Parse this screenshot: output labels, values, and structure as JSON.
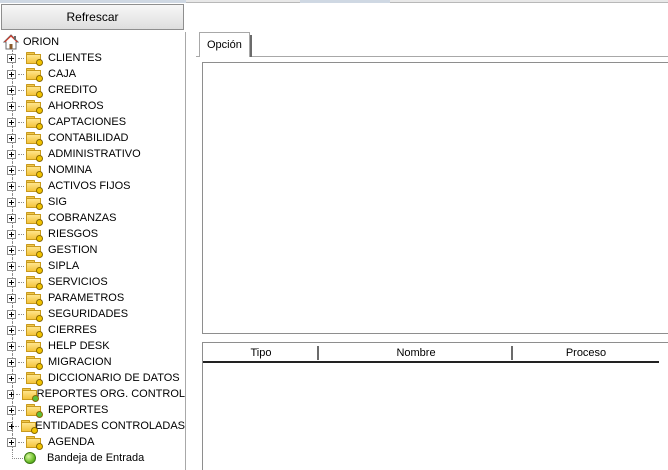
{
  "toolbar": {
    "refresh_label": "Refrescar"
  },
  "tree": {
    "root": "ORION",
    "modules": [
      {
        "label": "CLIENTES",
        "dot": "#f2c400"
      },
      {
        "label": "CAJA",
        "dot": "#f2c400"
      },
      {
        "label": "CREDITO",
        "dot": "#f2c400"
      },
      {
        "label": "AHORROS",
        "dot": "#f2c400"
      },
      {
        "label": "CAPTACIONES",
        "dot": "#f2c400"
      },
      {
        "label": "CONTABILIDAD",
        "dot": "#f2c400"
      },
      {
        "label": "ADMINISTRATIVO",
        "dot": "#f2c400"
      },
      {
        "label": "NOMINA",
        "dot": "#f2c400"
      },
      {
        "label": "ACTIVOS FIJOS",
        "dot": "#f2c400"
      },
      {
        "label": "SIG",
        "dot": "#f2c400"
      },
      {
        "label": "COBRANZAS",
        "dot": "#f2c400"
      },
      {
        "label": "RIESGOS",
        "dot": "#f2c400"
      },
      {
        "label": "GESTION",
        "dot": "#f2c400"
      },
      {
        "label": "SIPLA",
        "dot": "#f2c400"
      },
      {
        "label": "SERVICIOS",
        "dot": "#f2c400"
      },
      {
        "label": "PARAMETROS",
        "dot": "#f2c400"
      },
      {
        "label": "SEGURIDADES",
        "dot": "#f2c400"
      },
      {
        "label": "CIERRES",
        "dot": "#f2c400"
      },
      {
        "label": "HELP DESK",
        "dot": "#f2c400"
      },
      {
        "label": "MIGRACION",
        "dot": "#f2c400"
      },
      {
        "label": "DICCIONARIO DE DATOS",
        "dot": "#f2c400"
      },
      {
        "label": "REPORTES ORG. CONTROL",
        "dot": "#5cbf3a"
      },
      {
        "label": "REPORTES",
        "dot": "#5cbf3a"
      },
      {
        "label": "ENTIDADES CONTROLADAS",
        "dot": "#f2c400"
      },
      {
        "label": "AGENDA",
        "dot": "#f2c400"
      }
    ],
    "inbox": "Bandeja de Entrada"
  },
  "tabs": [
    {
      "label": "Opción"
    }
  ],
  "grid": {
    "columns": [
      "Tipo",
      "Nombre",
      "Proceso"
    ]
  }
}
